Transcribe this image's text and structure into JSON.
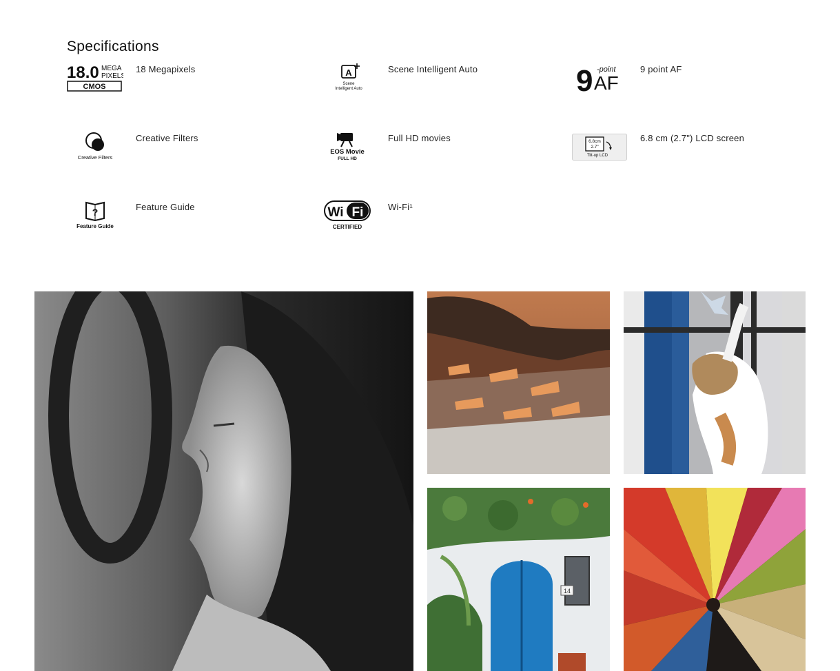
{
  "section": {
    "title": "Specifications"
  },
  "specs": [
    {
      "icon": "megapixels-cmos-icon",
      "label": "18 Megapixels",
      "icon_text": {
        "value": "18.0",
        "mega": "MEGA",
        "pixels": "PIXELS",
        "sensor": "CMOS"
      }
    },
    {
      "icon": "scene-intelligent-auto-icon",
      "label": "Scene Intelligent Auto",
      "icon_text": {
        "glyph": "A",
        "caption1": "Scene",
        "caption2": "Intelligent Auto"
      }
    },
    {
      "icon": "nine-point-af-icon",
      "label": "9 point AF",
      "icon_text": {
        "number": "9",
        "top": "-point",
        "af": "AF"
      }
    },
    {
      "icon": "creative-filters-icon",
      "label": "Creative Filters",
      "icon_text": {
        "caption": "Creative Filters"
      }
    },
    {
      "icon": "eos-movie-icon",
      "label": "Full HD movies",
      "icon_text": {
        "caption1": "EOS Movie",
        "caption2": "FULL HD"
      }
    },
    {
      "icon": "lcd-screen-icon",
      "label": "6.8 cm (2.7\") LCD screen",
      "icon_text": {
        "size1": "6.8cm",
        "size2": "2.7\"",
        "caption": "Tilt-up LCD"
      }
    },
    {
      "icon": "feature-guide-icon",
      "label": "Feature Guide",
      "icon_text": {
        "glyph": "?",
        "caption": "Feature Guide"
      }
    },
    {
      "icon": "wifi-certified-icon",
      "label": "Wi-Fi¹",
      "icon_text": {
        "wi": "Wi",
        "fi": "Fi",
        "caption": "CERTIFIED"
      }
    }
  ],
  "gallery": [
    {
      "name": "portrait-photo",
      "subject": "black and white portrait of a woman in profile"
    },
    {
      "name": "hillside-town-photo",
      "subject": "whitewashed hillside town at sunset"
    },
    {
      "name": "cat-photo",
      "subject": "cat reaching up by a blue door"
    },
    {
      "name": "blue-door-photo",
      "subject": "blue wooden door with plants",
      "house_number": "14"
    },
    {
      "name": "slippers-photo",
      "subject": "colorful leather slippers arranged in a circle"
    }
  ],
  "colors": {
    "text": "#222222",
    "title": "#111111",
    "background": "#ffffff"
  }
}
